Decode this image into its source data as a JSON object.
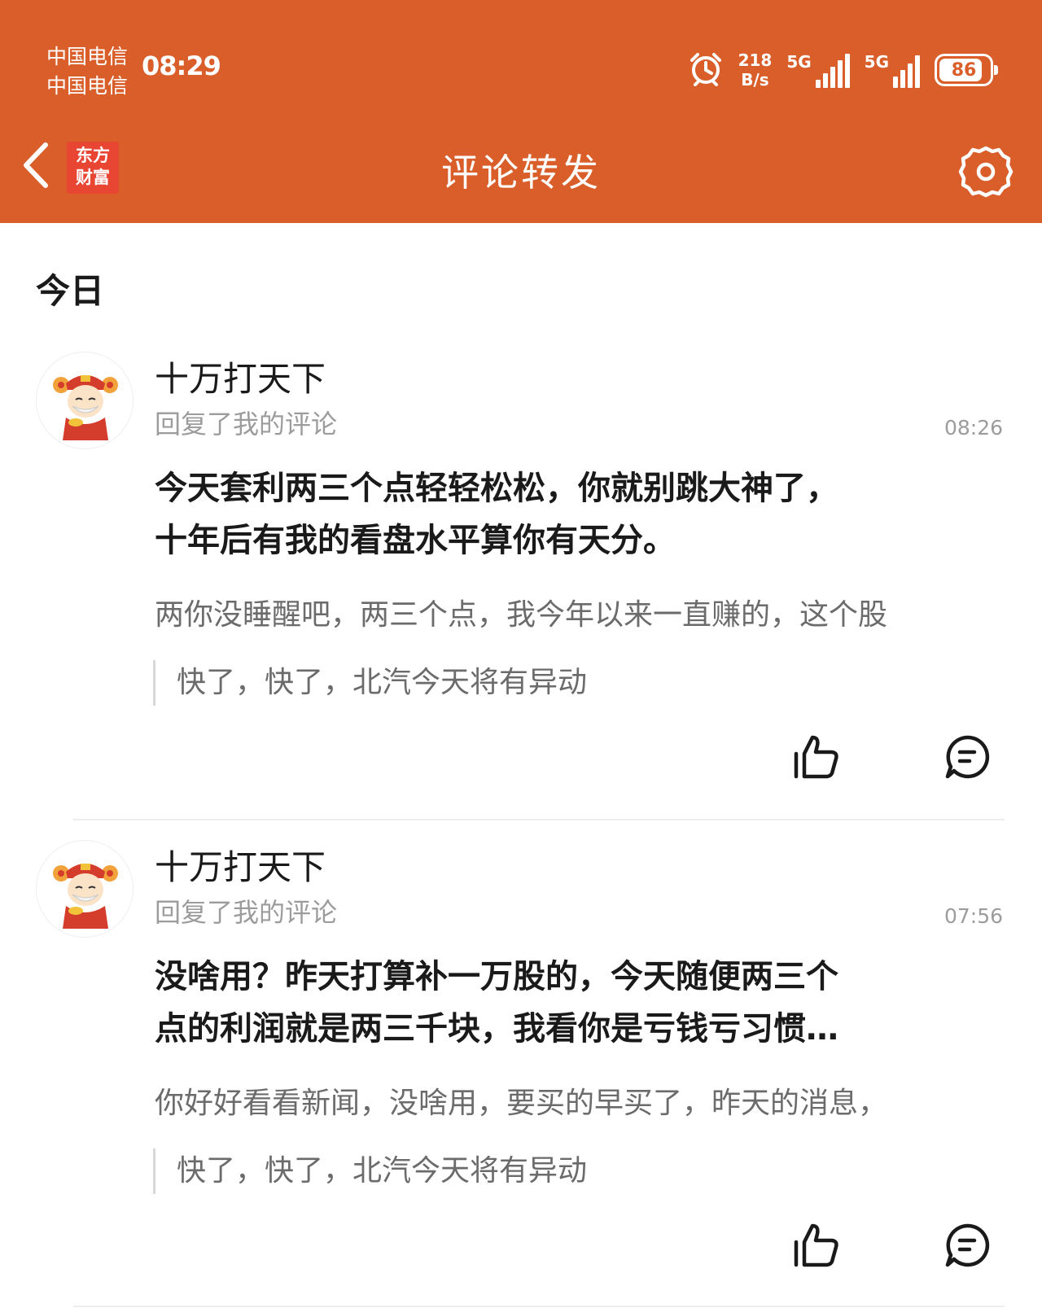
{
  "status_bar": {
    "carrier_1": "中国电信",
    "carrier_2": "中国电信",
    "time": "08:29",
    "net_speed_value": "218",
    "net_speed_unit": "B/s",
    "signal_1_label": "5G",
    "signal_1_sub": "4",
    "signal_2_label": "5G",
    "battery_level": "86",
    "battery_fraction": 0.86,
    "icons": [
      "alarm-clock-icon",
      "signal-icon",
      "battery-icon"
    ]
  },
  "nav": {
    "back_icon": "chevron-left-icon",
    "logo_line1": "东方",
    "logo_line2": "财富",
    "title": "评论转发",
    "settings_icon": "gear-icon"
  },
  "section_label": "今日",
  "items": [
    {
      "username": "十万打天下",
      "action": "回复了我的评论",
      "time": "08:26",
      "reply_line1": "今天套利两三个点轻轻松松，你就别跳大神了，",
      "reply_line2": "十年后有我的看盘水平算你有天分。",
      "my_comment": "两你没睡醒吧，两三个点，我今年以来一直赚的，这个股",
      "quoted_post": "快了，快了，北汽今天将有异动"
    },
    {
      "username": "十万打天下",
      "action": "回复了我的评论",
      "time": "07:56",
      "reply_line1": "没啥用？昨天打算补一万股的，今天随便两三个",
      "reply_line2": "点的利润就是两三千块，我看你是亏钱亏习惯…",
      "my_comment": "你好好看看新闻，没啥用，要买的早买了，昨天的消息，",
      "quoted_post": "快了，快了，北汽今天将有异动"
    }
  ],
  "colors": {
    "header_bg": "#d95e2a",
    "logo_bg": "#e84533",
    "secondary_text": "#9c9c9c",
    "comment_text": "#6b6b6b"
  }
}
